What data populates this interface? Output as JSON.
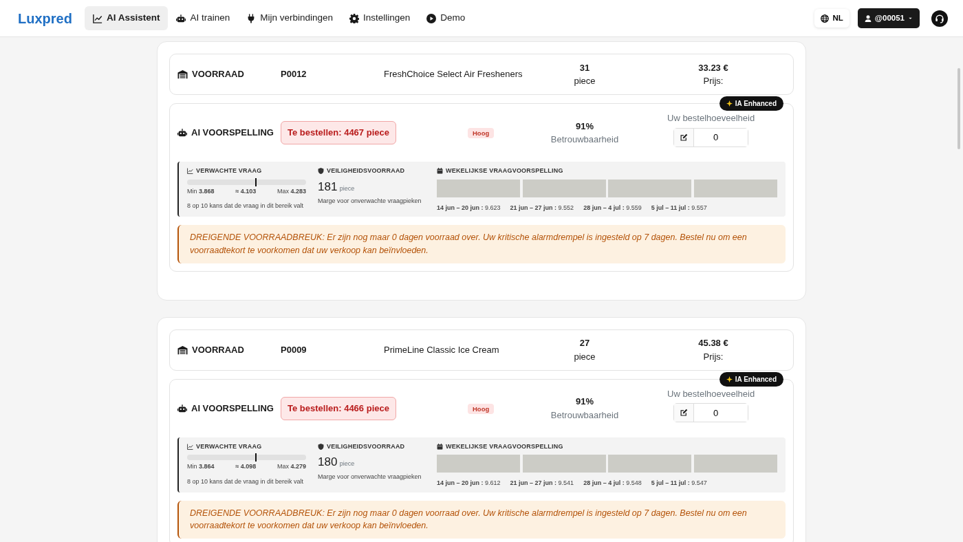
{
  "brand": "Luxpred",
  "nav": [
    {
      "label": "AI Assistent",
      "kind": "chart",
      "selected": true
    },
    {
      "label": "AI trainen",
      "kind": "robot",
      "selected": false
    },
    {
      "label": "Mijn verbindingen",
      "kind": "plug",
      "selected": false
    },
    {
      "label": "Instellingen",
      "kind": "gear",
      "selected": false
    },
    {
      "label": "Demo",
      "kind": "play",
      "selected": false
    }
  ],
  "language": "NL",
  "user": "@00051",
  "products": [
    {
      "stock_label": "VOORRAAD",
      "code": "P0012",
      "name": "FreshChoice Select Air Fresheners",
      "quantity": "31",
      "unit": "piece",
      "price": "33.23 €",
      "price_label": "Prijs:",
      "badge": "IA Enhanced",
      "forecast_label": "AI VOORSPELLING",
      "order": "Te bestellen: 4467 piece",
      "priority": "Hoog",
      "confidence": "91%",
      "confidence_label": "Betrouwbaarheid",
      "qty_label": "Uw bestelhoeveelheid",
      "qty_value": "0",
      "demand_title": "VERWACHTE VRAAG",
      "level": 0.57,
      "min_label": "Min",
      "min": "3.868",
      "mid": "≈ 4.103",
      "max_label": "Max",
      "max": "4.283",
      "demand_note": "8 op 10 kans dat de vraag in dit bereik valt",
      "safety_title": "VEILIGHEIDSVOORRAAD",
      "safety": "181",
      "safety_unit": "piece",
      "safety_note": "Marge voor onverwachte vraagpieken",
      "weekly_title": "WEKELIJKSE VRAAGVOORSPELLING",
      "weeks": [
        {
          "range": "14 jun – 20 jun :",
          "value": "9.623"
        },
        {
          "range": "21 jun – 27 jun :",
          "value": "9.552"
        },
        {
          "range": "28 jun – 4 jul :",
          "value": "9.559"
        },
        {
          "range": "5 jul – 11 jul :",
          "value": "9.557"
        }
      ],
      "alert": "DREIGENDE VOORRAADBREUK: Er zijn nog maar 0 dagen voorraad over. Uw kritische alarmdrempel is ingesteld op 7 dagen. Bestel nu om een voorraadtekort te voorkomen dat uw verkoop kan beïnvloeden."
    },
    {
      "stock_label": "VOORRAAD",
      "code": "P0009",
      "name": "PrimeLine Classic Ice Cream",
      "quantity": "27",
      "unit": "piece",
      "price": "45.38 €",
      "price_label": "Prijs:",
      "badge": "IA Enhanced",
      "forecast_label": "AI VOORSPELLING",
      "order": "Te bestellen: 4466 piece",
      "priority": "Hoog",
      "confidence": "91%",
      "confidence_label": "Betrouwbaarheid",
      "qty_label": "Uw bestelhoeveelheid",
      "qty_value": "0",
      "demand_title": "VERWACHTE VRAAG",
      "level": 0.57,
      "min_label": "Min",
      "min": "3.864",
      "mid": "≈ 4.098",
      "max_label": "Max",
      "max": "4.279",
      "demand_note": "8 op 10 kans dat de vraag in dit bereik valt",
      "safety_title": "VEILIGHEIDSVOORRAAD",
      "safety": "180",
      "safety_unit": "piece",
      "safety_note": "Marge voor onverwachte vraagpieken",
      "weekly_title": "WEKELIJKSE VRAAGVOORSPELLING",
      "weeks": [
        {
          "range": "14 jun – 20 jun :",
          "value": "9.612"
        },
        {
          "range": "21 jun – 27 jun :",
          "value": "9.541"
        },
        {
          "range": "28 jun – 4 jul :",
          "value": "9.548"
        },
        {
          "range": "5 jul – 11 jul :",
          "value": "9.547"
        }
      ],
      "alert": "DREIGENDE VOORRAADBREUK: Er zijn nog maar 0 dagen voorraad over. Uw kritische alarmdrempel is ingesteld op 7 dagen. Bestel nu om een voorraadtekort te voorkomen dat uw verkoop kan beïnvloeden."
    }
  ]
}
